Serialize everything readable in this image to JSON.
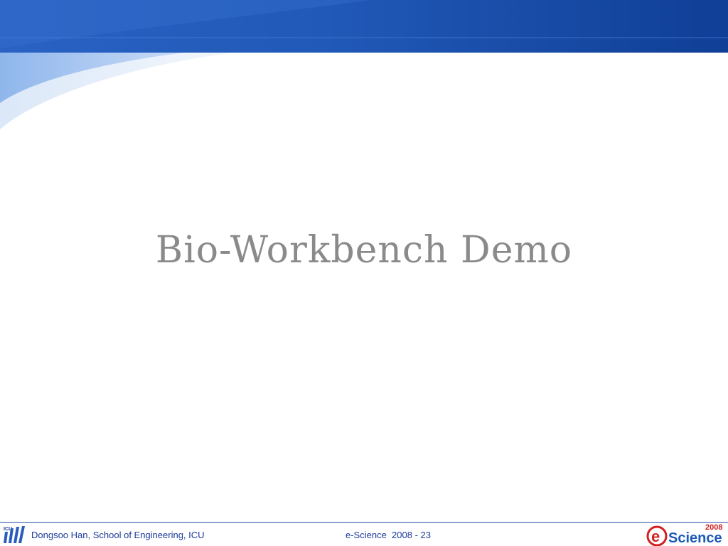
{
  "slide": {
    "title": "Bio-Workbench Demo"
  },
  "footer": {
    "author": "Dongsoo Han, School of Engineering, ICU",
    "center_text": "e-Science  2008 - 23"
  },
  "logos": {
    "left_logo_icon": "icu-logo-icon",
    "left_logo_text": "ICU",
    "right_logo_icon": "escience-2008-logo-icon",
    "right_logo_year": "2008",
    "right_logo_letter": "e",
    "right_logo_word": "Science"
  },
  "colors": {
    "banner_dark": "#1f4fb0",
    "banner_light": "#9cc0ee",
    "title_gray": "#8a8a8a",
    "footer_text": "#1c3a9a",
    "logo_red": "#d42020"
  }
}
